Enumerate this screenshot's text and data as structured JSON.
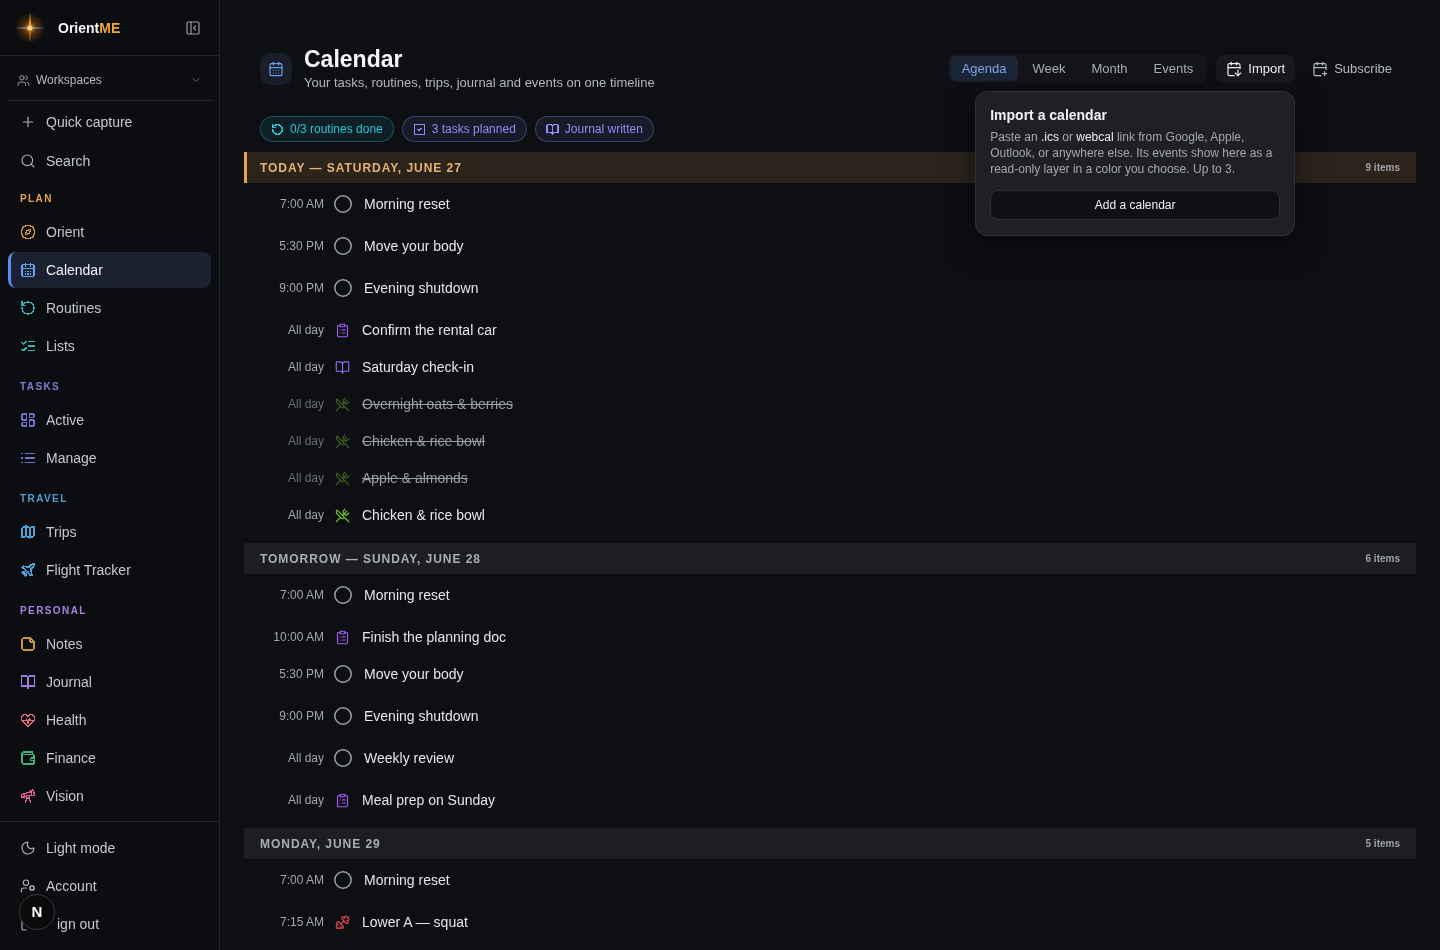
{
  "sidebar": {
    "brand": {
      "name": "Orient",
      "accent": "ME"
    },
    "workspace_switcher": {
      "label": "Workspaces"
    },
    "quick_actions": [
      {
        "label": "Quick capture"
      },
      {
        "label": "Search"
      }
    ],
    "sections": [
      {
        "title": "PLAN",
        "color": "#e0a458",
        "items": [
          {
            "label": "Orient",
            "color": "#e09a3e",
            "selected": false
          },
          {
            "label": "Calendar",
            "color": "#6b9ef0",
            "selected": true
          },
          {
            "label": "Routines",
            "color": "#2fb5ab",
            "selected": false
          },
          {
            "label": "Lists",
            "color": "#2fb5ab",
            "selected": false
          }
        ]
      },
      {
        "title": "TASKS",
        "color": "#7b7fd4",
        "items": [
          {
            "label": "Active",
            "color": "#6f74c9",
            "selected": false
          },
          {
            "label": "Manage",
            "color": "#6f74c9",
            "selected": false
          }
        ]
      },
      {
        "title": "TRAVEL",
        "color": "#4d9fd6",
        "items": [
          {
            "label": "Trips",
            "color": "#4d9fd6",
            "selected": false
          },
          {
            "label": "Flight Tracker",
            "color": "#4d9fd6",
            "selected": false
          }
        ]
      },
      {
        "title": "PERSONAL",
        "color": "#a782e6",
        "items": [
          {
            "label": "Notes",
            "color": "#c9973a",
            "selected": false
          },
          {
            "label": "Journal",
            "color": "#9d7be0",
            "selected": false
          },
          {
            "label": "Health",
            "color": "#e06b78",
            "selected": false
          },
          {
            "label": "Finance",
            "color": "#3fb57e",
            "selected": false
          },
          {
            "label": "Vision",
            "color": "#e0609a",
            "selected": false
          }
        ]
      }
    ],
    "footer": [
      {
        "label": "Light mode"
      },
      {
        "label": "Account"
      },
      {
        "label": "ign out"
      }
    ]
  },
  "dev_indicator": {
    "label": "N"
  },
  "page_header": {
    "title": "Calendar",
    "subtitle": "Your tasks, routines, trips, journal and events on one timeline"
  },
  "view_tabs": [
    {
      "label": "Agenda",
      "selected": true
    },
    {
      "label": "Week",
      "selected": false
    },
    {
      "label": "Month",
      "selected": false
    },
    {
      "label": "Events",
      "selected": false
    }
  ],
  "header_actions": [
    {
      "label": "Import",
      "expanded": true,
      "popover": {
        "title": "Import a calendar",
        "body": "Paste an **.ics** or **webcal** link from Google, Apple, Outlook, or anywhere else. Its events show here as a read-only layer in a color you choose. Up to 3.",
        "button": "Add a calendar"
      }
    },
    {
      "label": "Subscribe",
      "expanded": false
    }
  ],
  "summary_chips": [
    {
      "label": "0/3 routines done",
      "color": "#2cc4d2"
    },
    {
      "label": "3 tasks planned",
      "color": "#8f8ff7"
    },
    {
      "label": "Journal written",
      "color": "#8f8ff7"
    }
  ],
  "agenda": [
    {
      "title": "TODAY — SATURDAY, JUNE 27",
      "today": true,
      "count": "9 items",
      "items": [
        {
          "time": "7:00 AM",
          "title": "Morning reset",
          "kind": "routine",
          "done": false
        },
        {
          "time": "5:30 PM",
          "title": "Move your body",
          "kind": "routine",
          "done": false
        },
        {
          "time": "9:00 PM",
          "title": "Evening shutdown",
          "kind": "routine",
          "done": false
        },
        {
          "time": "All day",
          "title": "Confirm the rental car",
          "kind": "task",
          "done": false
        },
        {
          "time": "All day",
          "title": "Saturday check-in",
          "kind": "journal",
          "done": false
        },
        {
          "time": "All day",
          "title": "Overnight oats & berries",
          "kind": "meal",
          "done": true
        },
        {
          "time": "All day",
          "title": "Chicken & rice bowl",
          "kind": "meal",
          "done": true
        },
        {
          "time": "All day",
          "title": "Apple & almonds",
          "kind": "meal",
          "done": true
        },
        {
          "time": "All day",
          "title": "Chicken & rice bowl",
          "kind": "meal",
          "done": false
        }
      ]
    },
    {
      "title": "TOMORROW — SUNDAY, JUNE 28",
      "today": false,
      "count": "6 items",
      "items": [
        {
          "time": "7:00 AM",
          "title": "Morning reset",
          "kind": "routine",
          "done": false
        },
        {
          "time": "10:00 AM",
          "title": "Finish the planning doc",
          "kind": "task",
          "done": false
        },
        {
          "time": "5:30 PM",
          "title": "Move your body",
          "kind": "routine",
          "done": false
        },
        {
          "time": "9:00 PM",
          "title": "Evening shutdown",
          "kind": "routine",
          "done": false
        },
        {
          "time": "All day",
          "title": "Weekly review",
          "kind": "routine",
          "done": false
        },
        {
          "time": "All day",
          "title": "Meal prep on Sunday",
          "kind": "task",
          "done": false
        }
      ]
    },
    {
      "title": "MONDAY, JUNE 29",
      "today": false,
      "count": "5 items",
      "items": [
        {
          "time": "7:00 AM",
          "title": "Morning reset",
          "kind": "routine",
          "done": false
        },
        {
          "time": "7:15 AM",
          "title": "Lower A — squat",
          "kind": "workout",
          "done": false
        }
      ]
    }
  ]
}
